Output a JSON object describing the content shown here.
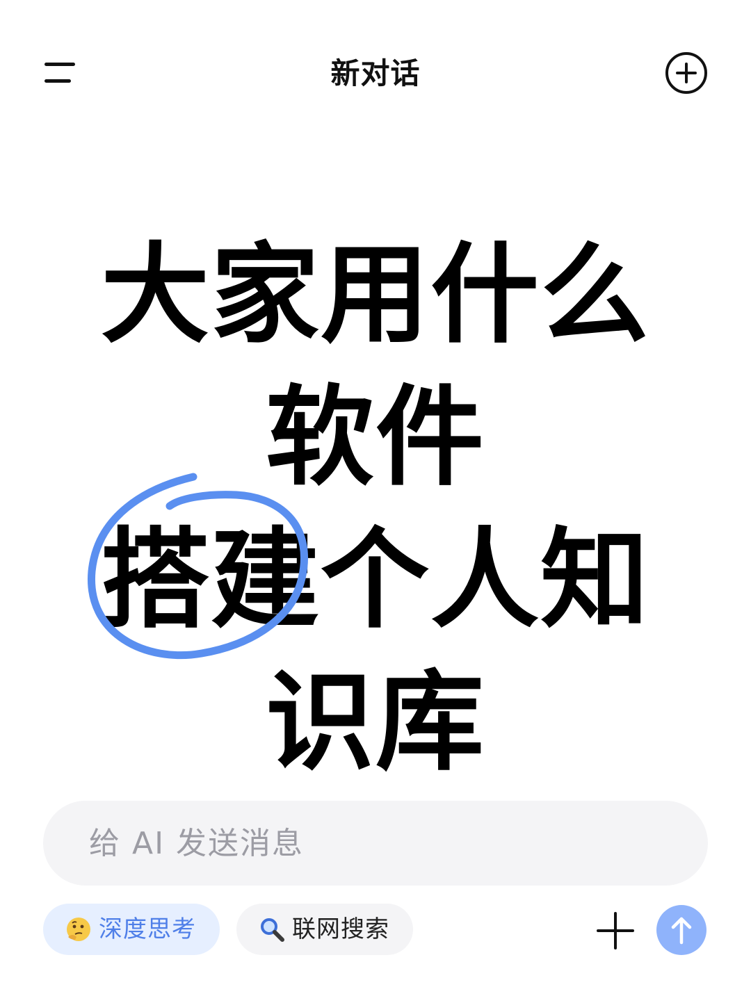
{
  "header": {
    "title": "新对话",
    "menu_icon": "menu-icon",
    "new_chat_icon": "plus-circle-icon"
  },
  "headline": {
    "lines": [
      "大家用什么",
      "软件",
      "搭建个人知",
      "识库"
    ],
    "highlight_color": "#5a8ff0"
  },
  "composer": {
    "placeholder": "给 AI 发送消息"
  },
  "toolbar": {
    "deep_think_label": "深度思考",
    "deep_think_icon": "thinking-face-icon",
    "web_search_label": "联网搜索",
    "web_search_icon": "magnifier-icon",
    "attach_icon": "plus-icon",
    "send_icon": "arrow-up-icon",
    "accent_color": "#4f7fe8",
    "send_color": "#8fb3fb"
  }
}
